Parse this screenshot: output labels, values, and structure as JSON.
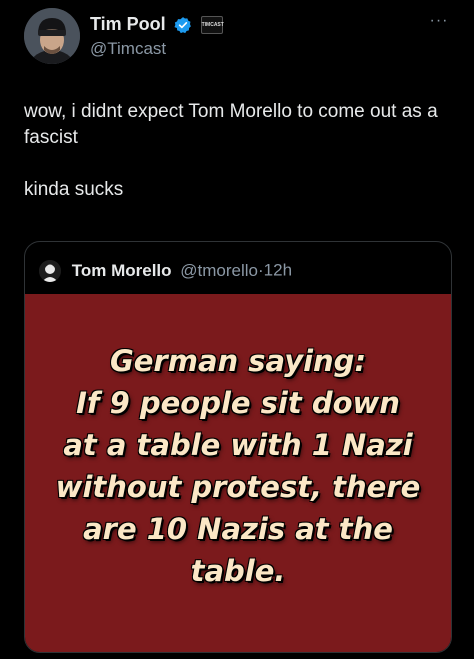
{
  "author": {
    "display_name": "Tim Pool",
    "handle": "@Timcast",
    "affiliate_badge": "TIMCAST",
    "verified_color": "#1d9bf0"
  },
  "more_label": "···",
  "tweet": {
    "paragraphs": [
      "wow, i didnt expect Tom Morello to come out as a fascist",
      "kinda sucks"
    ]
  },
  "quote": {
    "display_name": "Tom Morello",
    "handle": "@tmorello",
    "separator": "·",
    "time": "12h",
    "image_lines": [
      "German saying:",
      "If 9 people sit down",
      "at a table with 1 Nazi",
      "without protest, there",
      "are 10 Nazis at the",
      "table."
    ],
    "image_bg_color": "#7b1a1c",
    "image_text_color": "#fbe7c6"
  },
  "icons": {
    "avatar": "person-avatar",
    "verified": "verified-badge-icon",
    "more": "more-icon"
  }
}
